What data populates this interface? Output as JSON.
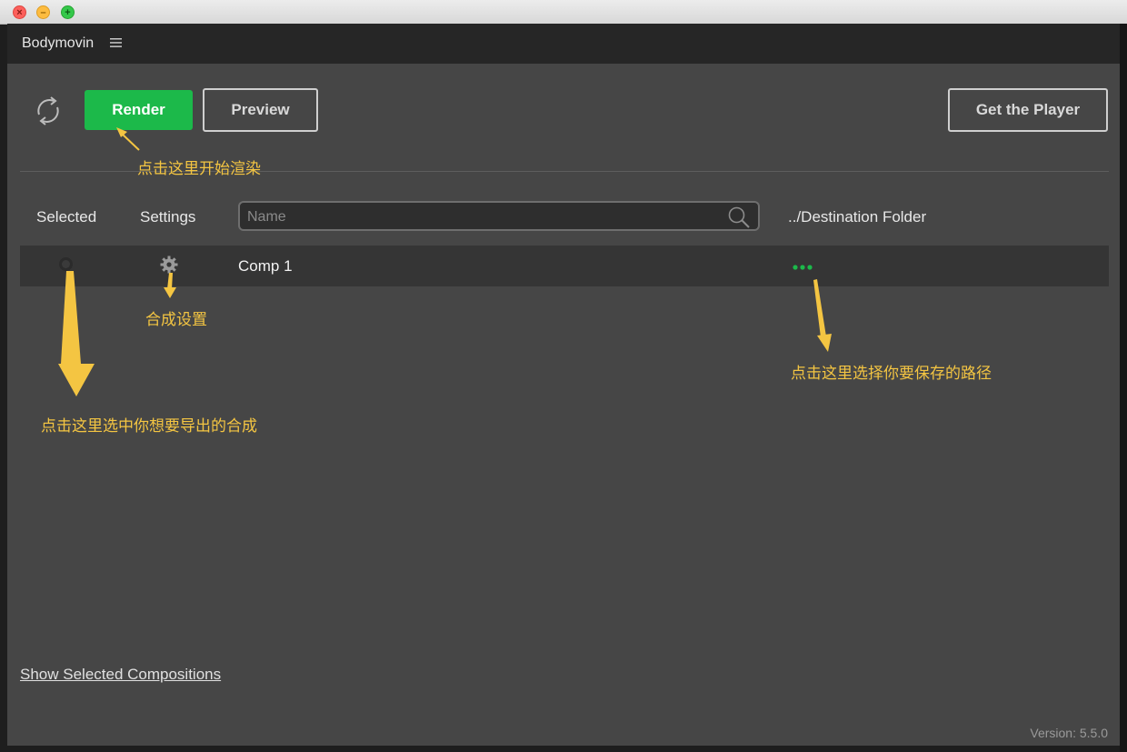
{
  "panel": {
    "title": "Bodymovin"
  },
  "toolbar": {
    "render_label": "Render",
    "preview_label": "Preview",
    "player_label": "Get the Player"
  },
  "columns": {
    "selected": "Selected",
    "settings": "Settings",
    "destination": "../Destination Folder"
  },
  "search": {
    "placeholder": "Name",
    "value": ""
  },
  "compositions": [
    {
      "name": "Comp 1",
      "selected": false
    }
  ],
  "annotations": {
    "render": "点击这里开始渲染",
    "settings": "合成设置",
    "destination": "点击这里选择你要保存的路径",
    "select": "点击这里选中你想要导出的合成"
  },
  "footer": {
    "show_selected": "Show Selected Compositions",
    "version": "Version: 5.5.0"
  },
  "colors": {
    "accent_green": "#1cb94a",
    "annotation": "#f4c542",
    "panel_bg": "#464646"
  },
  "icons": [
    "close-icon",
    "minimize-icon",
    "zoom-icon",
    "menu-icon",
    "refresh-icon",
    "search-icon",
    "gear-icon",
    "more-dots-icon",
    "radio-icon"
  ]
}
